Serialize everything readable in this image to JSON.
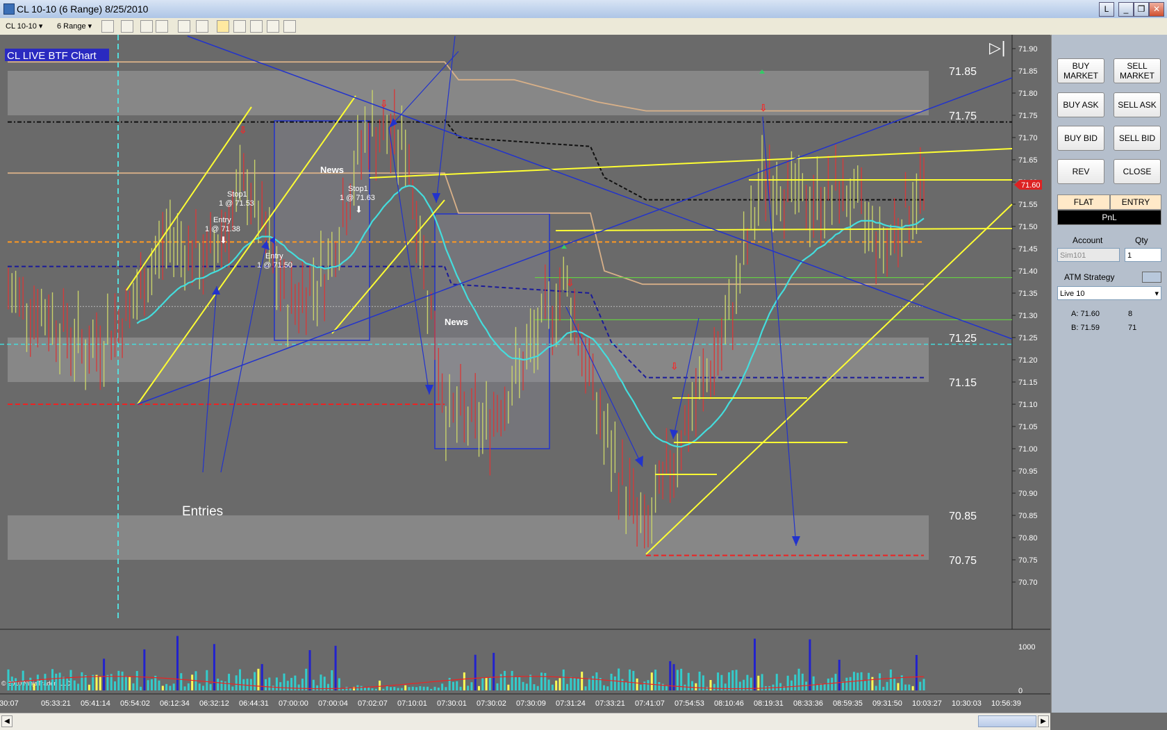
{
  "window": {
    "title": "CL 10-10 (6 Range)  8/25/2010",
    "buttons": [
      "L",
      "_",
      "❐",
      "✕"
    ]
  },
  "toolbar": {
    "instrument": "CL 10-10",
    "period": "6 Range"
  },
  "chart": {
    "label": "CL LIVE BTF Chart",
    "copyright": "© 2010 NinjaTrader, LLC",
    "annotations": {
      "entries": "Entries",
      "news_1": "News",
      "news_2": "News",
      "stop_1_a": "Stop1",
      "stop_1_a_price": "1 @ 71.53",
      "stop_1_b": "Stop1",
      "stop_1_b_price": "1 @ 71.63",
      "entry_1": "Entry",
      "entry_1_price": "1 @ 71.38",
      "entry_2": "Entry",
      "entry_2_price": "1 @ 71.50"
    },
    "zone_labels": [
      "71.85",
      "71.75",
      "71.25",
      "71.15",
      "70.85",
      "70.75"
    ],
    "current_price": "71.60",
    "price_axis": [
      "71.90",
      "71.85",
      "71.80",
      "71.75",
      "71.70",
      "71.65",
      "71.60",
      "71.55",
      "71.50",
      "71.45",
      "71.40",
      "71.35",
      "71.30",
      "71.25",
      "71.20",
      "71.15",
      "71.10",
      "71.05",
      "71.00",
      "70.95",
      "70.90",
      "70.85",
      "70.80",
      "70.75",
      "70.70"
    ],
    "volume_axis": [
      "1000",
      "0"
    ],
    "time_axis": [
      "5:30:07",
      "05:33:21",
      "05:41:14",
      "05:54:02",
      "06:12:34",
      "06:32:12",
      "06:44:31",
      "07:00:00",
      "07:00:04",
      "07:02:07",
      "07:10:01",
      "07:30:01",
      "07:30:02",
      "07:30:09",
      "07:31:24",
      "07:33:21",
      "07:41:07",
      "07:54:53",
      "08:10:46",
      "08:19:31",
      "08:33:36",
      "08:59:35",
      "09:31:50",
      "10:03:27",
      "10:30:03",
      "10:56:39"
    ],
    "colors": {
      "background": "#6a6a6a",
      "zone": "#8c8c8c",
      "up_bar": "#c8d26a",
      "down_bar": "#d23c3c",
      "trend_yellow": "#ffff33",
      "trend_blue": "#2233cc",
      "vwap_cyan": "#44dddd"
    }
  },
  "chart_data": {
    "type": "candlestick",
    "title": "",
    "ylim": [
      70.7,
      71.9
    ],
    "x": [
      "5:30:07",
      "05:33:21",
      "05:41:14",
      "05:54:02",
      "06:12:34",
      "06:32:12",
      "06:44:31",
      "07:00:00",
      "07:00:04",
      "07:02:07",
      "07:10:01",
      "07:30:01",
      "07:30:02",
      "07:30:09",
      "07:31:24",
      "07:33:21",
      "07:41:07",
      "07:54:53",
      "08:10:46",
      "08:19:31",
      "08:33:36",
      "08:59:35",
      "09:31:50",
      "10:03:27"
    ],
    "series": [
      {
        "values": [
          71.35,
          71.3,
          71.22,
          71.3,
          71.48,
          71.42,
          71.6,
          71.32,
          71.4,
          71.72,
          71.68,
          71.08,
          71.05,
          71.2,
          71.38,
          71.02,
          70.8,
          71.05,
          71.25,
          71.62,
          71.55,
          71.58,
          71.45,
          71.6
        ]
      }
    ],
    "levels": [
      71.85,
      71.75,
      71.25,
      71.15,
      70.85,
      70.75
    ],
    "volume_ylim": [
      0,
      1300
    ]
  },
  "panel": {
    "buy_market": "BUY MARKET",
    "sell_market": "SELL MARKET",
    "buy_ask": "BUY ASK",
    "sell_ask": "SELL ASK",
    "buy_bid": "BUY BID",
    "sell_bid": "SELL BID",
    "rev": "REV",
    "close": "CLOSE",
    "flat": "FLAT",
    "entry": "ENTRY",
    "pnl": "PnL",
    "account_label": "Account",
    "qty_label": "Qty",
    "account_value": "Sim101",
    "qty_value": "1",
    "atm_label": "ATM Strategy",
    "atm_value": "Live 10",
    "ask_label": "A: 71.60",
    "ask_size": "8",
    "bid_label": "B: 71.59",
    "bid_size": "71"
  }
}
